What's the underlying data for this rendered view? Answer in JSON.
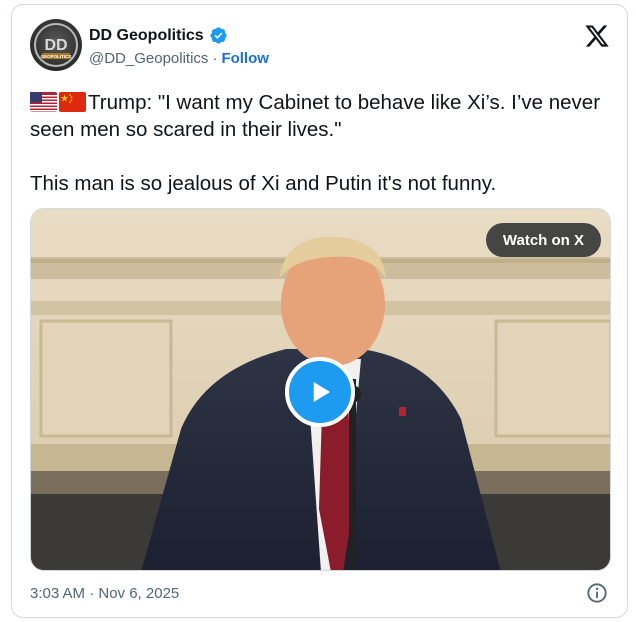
{
  "author": {
    "display_name": "DD Geopolitics",
    "handle": "@DD_Geopolitics",
    "separator": "·",
    "follow_label": "Follow",
    "avatar_text": "DD",
    "avatar_subtext": "GEOPOLITICS",
    "verified": true
  },
  "tweet": {
    "flags": [
      "us-flag-icon",
      "china-flag-icon"
    ],
    "line1": "Trump: \"I want my Cabinet to behave like Xi’s. I’ve never seen men so scared in their lives.\"",
    "line2": "This man is so jealous of Xi and Putin it's not funny."
  },
  "media": {
    "watch_label": "Watch on X",
    "play_icon": "play-icon"
  },
  "footer": {
    "timestamp": "3:03 AM · Nov 6, 2025",
    "info_icon": "info-icon"
  },
  "colors": {
    "accent": "#1d9bf0",
    "follow": "#1d6fcf",
    "text": "#0f1419",
    "muted": "#536471",
    "border": "#cfd9de"
  }
}
